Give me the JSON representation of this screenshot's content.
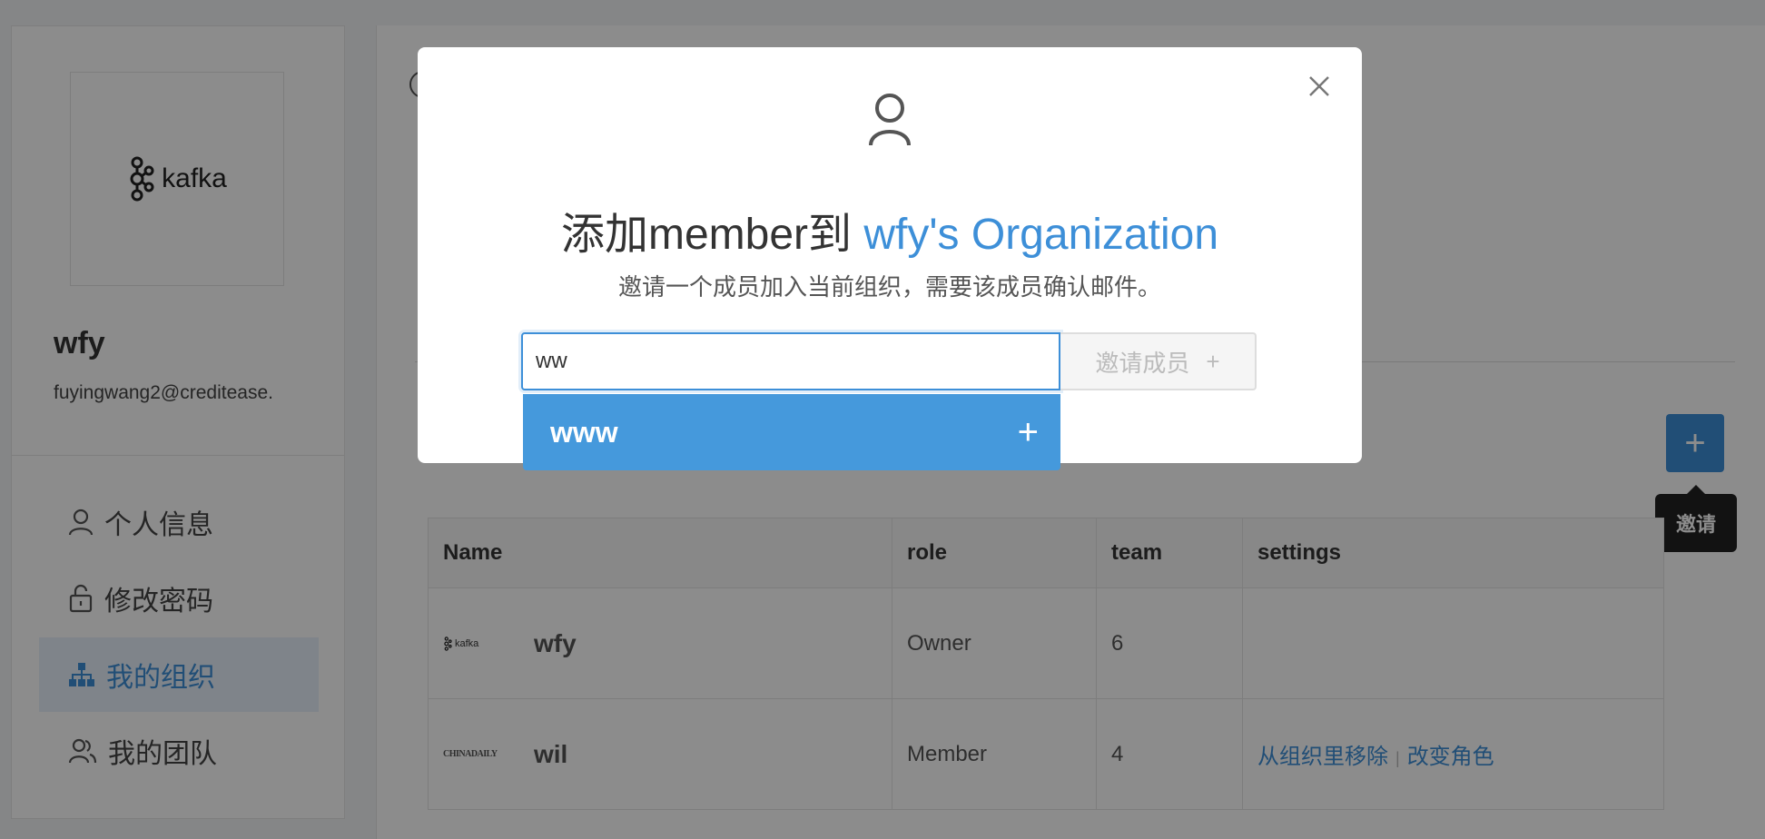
{
  "sidebar": {
    "logo_text": "kafka",
    "user_name": "wfy",
    "user_email": "fuyingwang2@creditease.",
    "menu": [
      {
        "label": "个人信息",
        "icon": "user-icon"
      },
      {
        "label": "修改密码",
        "icon": "lock-icon"
      },
      {
        "label": "我的组织",
        "icon": "org-tree-icon",
        "active": true
      },
      {
        "label": "我的团队",
        "icon": "team-icon"
      }
    ]
  },
  "main": {
    "add_button": "+",
    "tooltip": "邀请",
    "table": {
      "headers": [
        "Name",
        "role",
        "team",
        "settings"
      ],
      "rows": [
        {
          "logo": "kafka",
          "name": "wfy",
          "role": "Owner",
          "team": "6",
          "settings": []
        },
        {
          "logo": "CHINADAILY",
          "name": "wil",
          "role": "Member",
          "team": "4",
          "settings": [
            "从组织里移除",
            "改变角色"
          ]
        }
      ]
    }
  },
  "modal": {
    "title_prefix": "添加member到 ",
    "title_org": "wfy's Organization",
    "subtitle": "邀请一个成员加入当前组织，需要该成员确认邮件。",
    "input_value": "ww",
    "invite_button": "邀请成员",
    "invite_plus": "+",
    "suggestion": "www",
    "suggestion_plus": "+"
  },
  "colors": {
    "accent": "#3d8fd8",
    "dropdown": "#4599dc",
    "tooltip_bg": "#222222"
  }
}
